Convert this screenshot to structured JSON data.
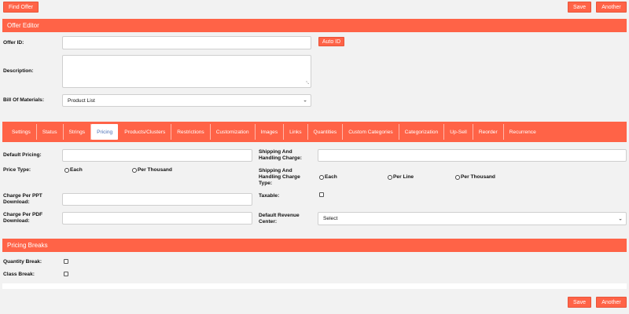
{
  "top_bar": {
    "find_offer_label": "Find Offer",
    "save_label": "Save",
    "another_label": "Another"
  },
  "offer_editor": {
    "title": "Offer Editor",
    "offer_id_label": "Offer ID:",
    "offer_id_value": "",
    "auto_id_label": "Auto ID",
    "description_label": "Description:",
    "description_value": "",
    "bom_label": "Bill Of Materials:",
    "bom_selected": "Product List"
  },
  "tabs": [
    {
      "label": "Settings",
      "active": false
    },
    {
      "label": "Status",
      "active": false
    },
    {
      "label": "Strings",
      "active": false
    },
    {
      "label": "Pricing",
      "active": true
    },
    {
      "label": "Products/Clusters",
      "active": false
    },
    {
      "label": "Restrictions",
      "active": false
    },
    {
      "label": "Customization",
      "active": false
    },
    {
      "label": "Images",
      "active": false
    },
    {
      "label": "Links",
      "active": false
    },
    {
      "label": "Quantities",
      "active": false
    },
    {
      "label": "Custom Categories",
      "active": false
    },
    {
      "label": "Categorization",
      "active": false
    },
    {
      "label": "Up-Sell",
      "active": false
    },
    {
      "label": "Reorder",
      "active": false
    },
    {
      "label": "Recurrence",
      "active": false
    }
  ],
  "pricing": {
    "default_pricing_label": "Default Pricing:",
    "default_pricing_value": "",
    "price_type_label": "Price Type:",
    "price_type_options": [
      "Each",
      "Per Thousand"
    ],
    "charge_ppt_label_1": "Charge Per PPT",
    "charge_ppt_label_2": "Download:",
    "charge_pdf_label_1": "Charge Per PDF",
    "charge_pdf_label_2": "Download:",
    "shipping_label_1": "Shipping And",
    "shipping_label_2": "Handling Charge:",
    "shipping_type_label_1": "Shipping And",
    "shipping_type_label_2": "Handling Charge",
    "shipping_type_label_3": "Type:",
    "shipping_type_options": [
      "Each",
      "Per Line",
      "Per Thousand"
    ],
    "taxable_label": "Taxable:",
    "revenue_label_1": "Default Revenue",
    "revenue_label_2": "Center:",
    "revenue_selected": "Select"
  },
  "pricing_breaks": {
    "title": "Pricing Breaks",
    "quantity_break_label": "Quantity Break:",
    "class_break_label": "Class Break:"
  },
  "bottom_bar": {
    "save_label": "Save",
    "another_label": "Another"
  },
  "colors": {
    "accent": "#ff6347",
    "background": "#f2f2f2",
    "active_tab_text": "#4a6fb5"
  }
}
